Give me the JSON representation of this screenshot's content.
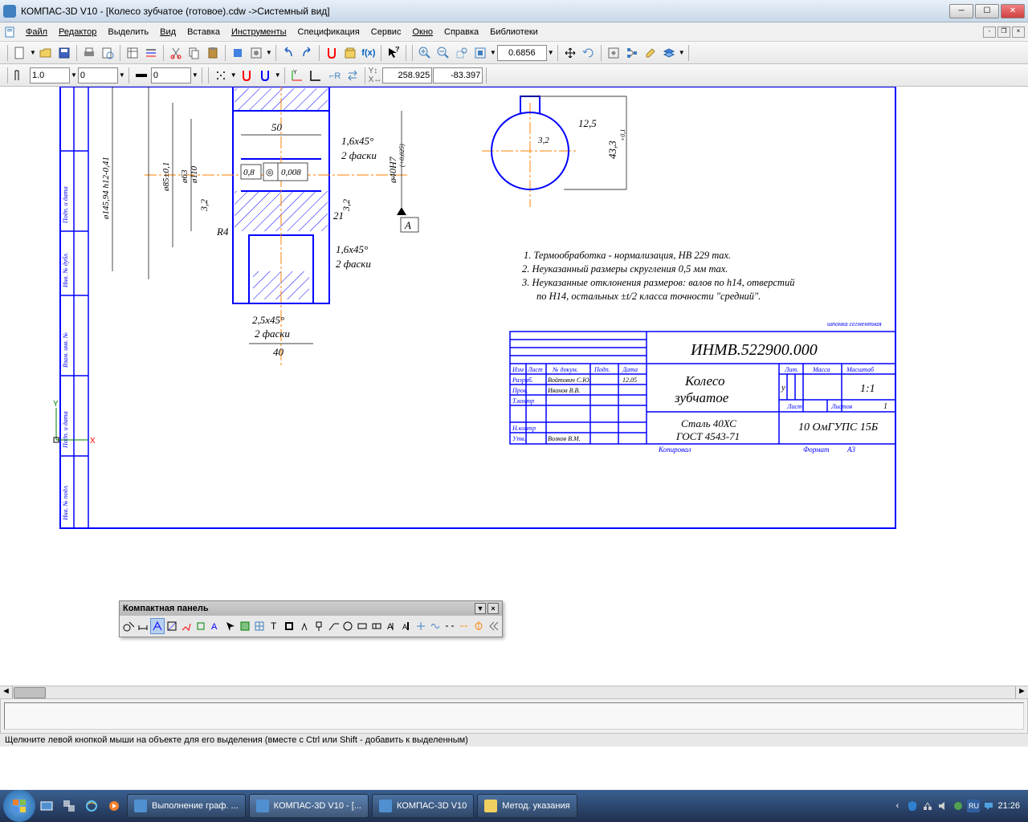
{
  "window": {
    "title": "КОМПАС-3D V10 - [Колесо зубчатое (готовое).cdw ->Системный вид]"
  },
  "menu": {
    "file": "Файл",
    "edit": "Редактор",
    "select": "Выделить",
    "view": "Вид",
    "insert": "Вставка",
    "tools": "Инструменты",
    "spec": "Спецификация",
    "service": "Сервис",
    "window": "Окно",
    "help": "Справка",
    "libs": "Библиотеки"
  },
  "toolbar2": {
    "line_weight": "1.0",
    "layer": "0",
    "style": "0",
    "zoom": "0.6856",
    "coord_x": "258.925",
    "coord_y": "-83.397"
  },
  "drawing": {
    "dims": {
      "d50": "50",
      "c1645_1": "1,6x45°",
      "f2_1": "2 фаски",
      "tol08": "0,8",
      "tol0008": "0,008",
      "r32_left": "3,2",
      "r21": "21",
      "r32_right": "3,2",
      "r4": "R4",
      "c1645_2": "1,6x45°",
      "f2_2": "2 фаски",
      "c2545": "2,5x45°",
      "f2_3": "2 фаски",
      "d40": "40",
      "dia_shaft": "ø40H7",
      "tol_shaft": "(+0,025)",
      "dia_145": "ø145,94 h12-0,41",
      "dia_85": "ø85±0,1",
      "dia_63": "ø63",
      "dia_110": "ø110",
      "sectA": "А",
      "key32": "3,2",
      "key125": "12,5",
      "key433": "43,3",
      "key433t": "+0,1"
    },
    "notes": {
      "n1": "1. Термообработка - нормализация, HB 229 max.",
      "n2": "2. Неуказанный размеры скругления 0,5 мм max.",
      "n3a": "3. Неуказанные отклонения размеров: валов по h14, отверстий",
      "n3b": "по H14, остальных ±t/2 класса точности \"средний\"."
    },
    "stamp": {
      "lbl_small": "шпонка сегментная",
      "number": "ИНМВ.522900.000",
      "name1": "Колесо",
      "name2": "зубчатое",
      "material1": "Сталь 40ХС",
      "material2": "ГОСТ 4543-71",
      "org": "10 ОмГУПС 15Б",
      "scale": "1:1",
      "izm": "Изм",
      "list": "Лист",
      "ndok": "№ докум.",
      "podp": "Подп.",
      "data": "Дата",
      "razrab": "Разраб.",
      "prov": "Пров.",
      "tkontr": "Т.контр",
      "nkontr": "Н.контр",
      "utv": "Утв.",
      "name_razrab": "Войтович С.Ю.",
      "date_razrab": "12.05",
      "name_prov": "Иванов В.В.",
      "name_utv": "Волков В.М.",
      "lit": "Лит.",
      "massa": "Масса",
      "masshtab": "Масштаб",
      "u": "у",
      "list2": "Лист",
      "listov": "Листов",
      "listov_n": "1",
      "kopiroval": "Копировал",
      "format": "Формат",
      "format_v": "А3"
    },
    "side_labels": {
      "l1": "Подп. и дата",
      "l2": "Инв. № дубл.",
      "l3": "Взам. инв. №",
      "l4": "Подп. и дата",
      "l5": "Инв. № подл."
    }
  },
  "float_panel": {
    "title": "Компактная панель"
  },
  "status": {
    "hint": "Щелкните левой кнопкой мыши на объекте для его выделения (вместе с Ctrl или Shift - добавить к выделенным)"
  },
  "taskbar": {
    "t1": "Выполнение граф. ...",
    "t2": "КОМПАС-3D V10 - [...",
    "t3": "КОМПАС-3D V10",
    "t4": "Метод. указания",
    "lang": "RU",
    "time": "21:26"
  }
}
